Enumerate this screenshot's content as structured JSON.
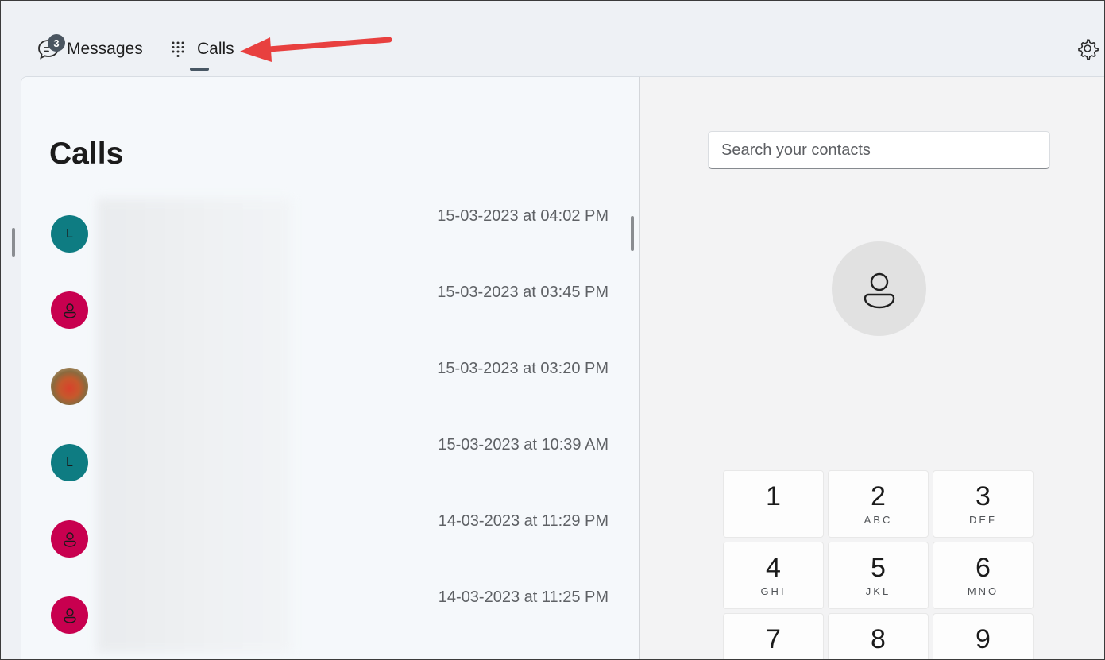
{
  "nav": {
    "messages_label": "Messages",
    "messages_badge": "3",
    "calls_label": "Calls",
    "icons": {
      "messages": "chat-bubble-icon",
      "calls": "dialpad-icon",
      "settings": "gear-icon"
    }
  },
  "annotation": {
    "arrow_color": "#e8403f"
  },
  "calls": {
    "title": "Calls",
    "items": [
      {
        "avatar": "L",
        "avatar_type": "letter",
        "avatar_color": "#0e7c82",
        "time": "15-03-2023 at 04:02 PM"
      },
      {
        "avatar": "person-icon",
        "avatar_type": "icon",
        "avatar_color": "#c8004f",
        "time": "15-03-2023 at 03:45 PM"
      },
      {
        "avatar": "photo",
        "avatar_type": "photo",
        "avatar_color": "",
        "time": "15-03-2023 at 03:20 PM"
      },
      {
        "avatar": "L",
        "avatar_type": "letter",
        "avatar_color": "#0e7c82",
        "time": "15-03-2023 at 10:39 AM"
      },
      {
        "avatar": "person-icon",
        "avatar_type": "icon",
        "avatar_color": "#c8004f",
        "time": "14-03-2023 at 11:29 PM"
      },
      {
        "avatar": "person-icon",
        "avatar_type": "icon",
        "avatar_color": "#c8004f",
        "time": "14-03-2023 at 11:25 PM"
      }
    ]
  },
  "dialer": {
    "search_placeholder": "Search your contacts",
    "keys": [
      {
        "digit": "1",
        "letters": ""
      },
      {
        "digit": "2",
        "letters": "ABC"
      },
      {
        "digit": "3",
        "letters": "DEF"
      },
      {
        "digit": "4",
        "letters": "GHI"
      },
      {
        "digit": "5",
        "letters": "JKL"
      },
      {
        "digit": "6",
        "letters": "MNO"
      },
      {
        "digit": "7",
        "letters": ""
      },
      {
        "digit": "8",
        "letters": ""
      },
      {
        "digit": "9",
        "letters": ""
      }
    ]
  }
}
